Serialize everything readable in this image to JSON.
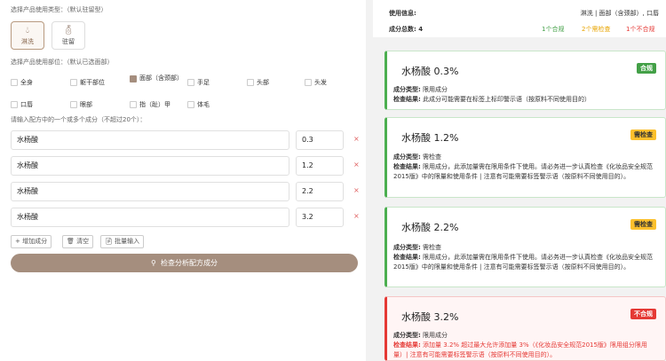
{
  "left": {
    "type_label": "选择产品使用类型：（默认驻留型）",
    "types": [
      {
        "label": "淋洗",
        "icon": "droplet-icon"
      },
      {
        "label": "驻留",
        "icon": "bottle-icon"
      }
    ],
    "part_label": "选择产品使用部位：（默认已选面部）",
    "parts": [
      {
        "label": "全身",
        "checked": false
      },
      {
        "label": "躯干部位",
        "checked": false
      },
      {
        "label": "面部（含颈部）",
        "checked": true
      },
      {
        "label": "手足",
        "checked": false
      },
      {
        "label": "头部",
        "checked": false
      },
      {
        "label": "头发",
        "checked": false
      },
      {
        "label": "口唇",
        "checked": false
      },
      {
        "label": "眼部",
        "checked": false
      },
      {
        "label": "指（趾）甲",
        "checked": false
      },
      {
        "label": "体毛",
        "checked": false
      }
    ],
    "ingredient_label": "请输入配方中的一个或多个成分（不超过20个）：",
    "ingredients": [
      {
        "name": "水杨酸",
        "amount": "0.3"
      },
      {
        "name": "水杨酸",
        "amount": "1.2"
      },
      {
        "name": "水杨酸",
        "amount": "2.2"
      },
      {
        "name": "水杨酸",
        "amount": "3.2"
      }
    ],
    "delete_symbol": "×",
    "add_button": "+ 增加成分",
    "clear_button": "清空",
    "batch_button": "批量输入",
    "analyze_button": "检查分析配方成分"
  },
  "summary": {
    "usage_label": "使用信息:",
    "usage_value": "淋洗 | 面部（含颈部）, 口唇",
    "total_label": "成分总数: 4",
    "ok_count": "1个合规",
    "warn_count": "2个需检查",
    "bad_count": "1个不合规"
  },
  "results": [
    {
      "name": "水杨酸 0.3%",
      "badge": "合规",
      "status": "ok",
      "type_label": "成分类型:",
      "type": "限用成分",
      "result_label": "检查结果:",
      "result": "此成分可能需要在标签上标印警示语（按原料不同使用目的）"
    },
    {
      "name": "水杨酸 1.2%",
      "badge": "需检查",
      "status": "warn",
      "type_label": "成分类型:",
      "type": "需检查",
      "result_label": "检查结果:",
      "result": "限用成分，此添加量需在限用条件下使用。请必务进一步认真检查《化妆品安全规范2015版》中的限量和使用条件 | 注意有可能需要标签警示语（按原料不同使用目的）。"
    },
    {
      "name": "水杨酸 2.2%",
      "badge": "需检查",
      "status": "warn",
      "type_label": "成分类型:",
      "type": "需检查",
      "result_label": "检查结果:",
      "result": "限用成分，此添加量需在限用条件下使用。请必务进一步认真检查《化妆品安全规范2015版》中的限量和使用条件 | 注意有可能需要标签警示语（按原料不同使用目的）。"
    },
    {
      "name": "水杨酸 3.2%",
      "badge": "不合规",
      "status": "bad",
      "type_label": "成分类型:",
      "type": "限用成分",
      "result_label": "检查结果:",
      "result": "添加量 3.2% 超过最大允许添加量 3%（《化妆品安全规范2015版》限用组分限用量）| 注意有可能需要标签警示语（按原料不同使用目的）。"
    }
  ],
  "colors": {
    "accent": "#a58e7e",
    "ok": "#43a047",
    "warn": "#fbc02d",
    "bad": "#e53935"
  }
}
